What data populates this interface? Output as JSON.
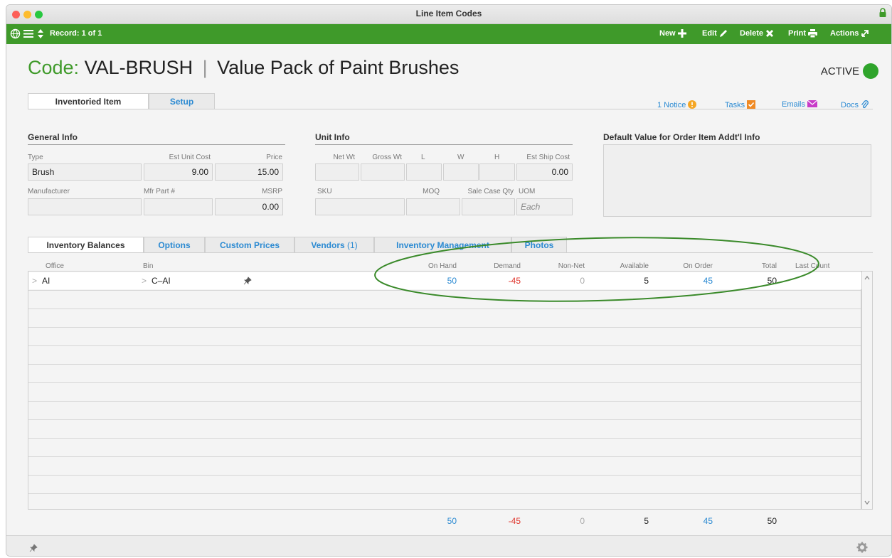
{
  "window": {
    "title": "Line Item Codes"
  },
  "toolbar": {
    "record": "Record: 1 of 1",
    "new_label": "New",
    "edit_label": "Edit",
    "delete_label": "Delete",
    "print_label": "Print",
    "actions_label": "Actions"
  },
  "header": {
    "code_prefix": "Code:",
    "code": "VAL-BRUSH",
    "separator": "|",
    "name": "Value Pack of Paint Brushes",
    "status": "ACTIVE",
    "status_color": "#2fa42b"
  },
  "main_tabs": [
    {
      "label": "Inventoried Item"
    },
    {
      "label": "Setup"
    }
  ],
  "links": {
    "notice": "1 Notice",
    "tasks": "Tasks",
    "emails": "Emails",
    "docs": "Docs"
  },
  "general_info": {
    "title": "General Info",
    "type_label": "Type",
    "type_value": "Brush",
    "est_unit_cost_label": "Est Unit Cost",
    "est_unit_cost_value": "9.00",
    "price_label": "Price",
    "price_value": "15.00",
    "manufacturer_label": "Manufacturer",
    "manufacturer_value": "",
    "mfr_part_label": "Mfr Part #",
    "mfr_part_value": "",
    "msrp_label": "MSRP",
    "msrp_value": "0.00"
  },
  "unit_info": {
    "title": "Unit Info",
    "net_wt_label": "Net Wt",
    "gross_wt_label": "Gross Wt",
    "l_label": "L",
    "w_label": "W",
    "h_label": "H",
    "est_ship_cost_label": "Est Ship Cost",
    "est_ship_cost_value": "0.00",
    "sku_label": "SKU",
    "moq_label": "MOQ",
    "sale_case_qty_label": "Sale Case Qty",
    "uom_label": "UOM",
    "uom_placeholder": "Each"
  },
  "default_value": {
    "title": "Default Value for Order Item Addt'l Info",
    "value": ""
  },
  "sub_tabs": [
    {
      "label": "Inventory Balances"
    },
    {
      "label": "Options"
    },
    {
      "label": "Custom Prices"
    },
    {
      "label": "Vendors",
      "count": "(1)"
    },
    {
      "label": "Inventory Management"
    },
    {
      "label": "Photos"
    }
  ],
  "table": {
    "columns": [
      "Office",
      "Bin",
      "On Hand",
      "Demand",
      "Non-Net",
      "Available",
      "On Order",
      "Total",
      "Last Count"
    ],
    "rows": [
      {
        "expand_office": ">",
        "office": "AI",
        "expand_bin": ">",
        "bin": "C–AI",
        "on_hand": "50",
        "demand": "-45",
        "non_net": "0",
        "available": "5",
        "on_order": "45",
        "total": "50",
        "last_count": ""
      }
    ],
    "totals": {
      "on_hand": "50",
      "demand": "-45",
      "non_net": "0",
      "available": "5",
      "on_order": "45",
      "total": "50"
    }
  },
  "colors": {
    "accent_green": "#3f9a2a",
    "link_blue": "#2b8ad2",
    "negative_red": "#e0342b",
    "annotation_green": "#3a8a2a"
  }
}
